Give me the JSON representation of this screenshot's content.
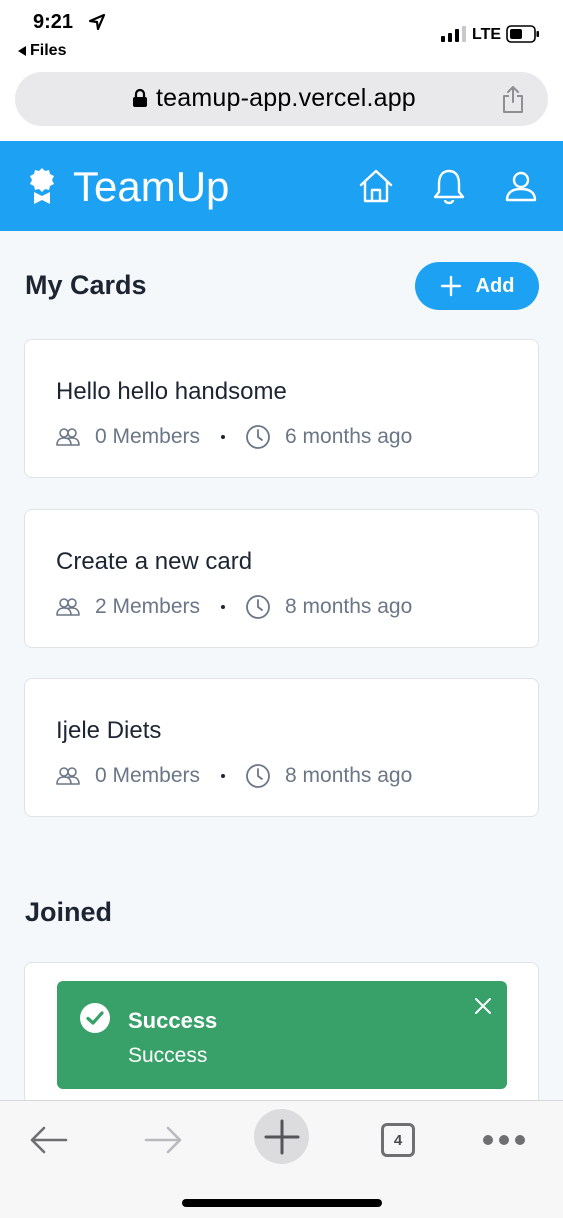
{
  "status_bar": {
    "time": "9:21",
    "back_label": "Files",
    "network": "LTE"
  },
  "url_bar": {
    "url": "teamup-app.vercel.app"
  },
  "header": {
    "brand": "TeamUp",
    "color": "#1da1f2"
  },
  "my_cards": {
    "title": "My Cards",
    "add_label": "Add",
    "cards": [
      {
        "title": "Hello hello handsome",
        "members": "0 Members",
        "time": "6 months ago"
      },
      {
        "title": "Create a new card",
        "members": "2 Members",
        "time": "8 months ago"
      },
      {
        "title": "Ijele Diets",
        "members": "0 Members",
        "time": "8 months ago"
      }
    ]
  },
  "joined": {
    "title": "Joined"
  },
  "toast": {
    "title": "Success",
    "message": "Success",
    "color": "#38a169"
  },
  "toolbar": {
    "tab_count": "4"
  }
}
